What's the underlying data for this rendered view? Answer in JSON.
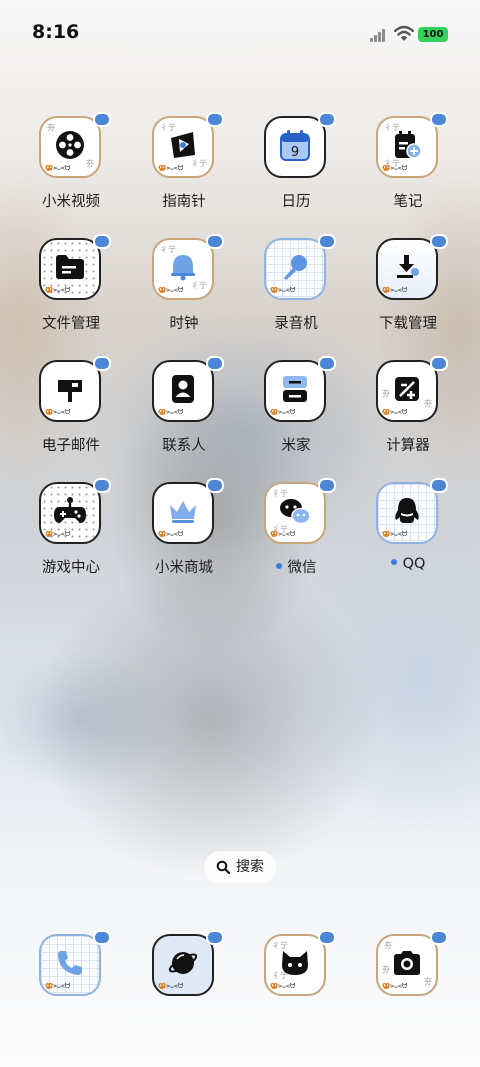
{
  "status_bar": {
    "time": "8:16",
    "battery": "100"
  },
  "apps": [
    {
      "label": "小米视频",
      "icon": "film-reel-icon"
    },
    {
      "label": "指南针",
      "icon": "compass-icon"
    },
    {
      "label": "日历",
      "icon": "calendar-icon",
      "date": "9"
    },
    {
      "label": "笔记",
      "icon": "notes-icon"
    },
    {
      "label": "文件管理",
      "icon": "folder-icon"
    },
    {
      "label": "时钟",
      "icon": "bell-icon"
    },
    {
      "label": "录音机",
      "icon": "microphone-icon"
    },
    {
      "label": "下载管理",
      "icon": "download-icon"
    },
    {
      "label": "电子邮件",
      "icon": "mailbox-icon"
    },
    {
      "label": "联系人",
      "icon": "contact-card-icon"
    },
    {
      "label": "米家",
      "icon": "home-device-icon"
    },
    {
      "label": "计算器",
      "icon": "calculator-icon"
    },
    {
      "label": "游戏中心",
      "icon": "gamepad-icon"
    },
    {
      "label": "小米商城",
      "icon": "crown-icon"
    },
    {
      "label": "微信",
      "icon": "chat-bubbles-icon"
    },
    {
      "label": "QQ",
      "icon": "penguin-icon"
    }
  ],
  "icon_mark": "🥨>ᴗ<ᗢ",
  "search": {
    "label": "搜索"
  },
  "dock": [
    {
      "name": "phone",
      "icon": "phone-icon"
    },
    {
      "name": "browser",
      "icon": "planet-icon"
    },
    {
      "name": "cat-app",
      "icon": "cat-icon"
    },
    {
      "name": "camera",
      "icon": "camera-icon"
    }
  ],
  "colors": {
    "accent": "#4d86d6",
    "battery": "#33d35b",
    "notification_dot": "#3b7de0"
  }
}
